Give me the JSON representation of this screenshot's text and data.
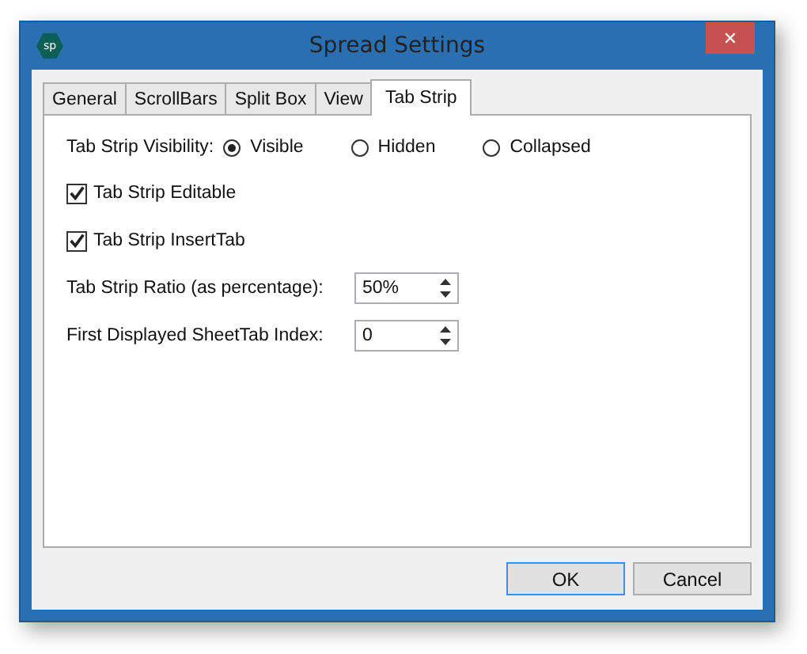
{
  "window": {
    "title": "Spread Settings",
    "icon_text": "sp",
    "close": "✕"
  },
  "tabs": [
    {
      "label": "General",
      "selected": false
    },
    {
      "label": "ScrollBars",
      "selected": false
    },
    {
      "label": "Split Box",
      "selected": false
    },
    {
      "label": "View",
      "selected": false
    },
    {
      "label": "Tab Strip",
      "selected": true
    }
  ],
  "visibility": {
    "label": "Tab Strip Visibility:",
    "options": [
      {
        "label": "Visible",
        "selected": true
      },
      {
        "label": "Hidden",
        "selected": false
      },
      {
        "label": "Collapsed",
        "selected": false
      }
    ]
  },
  "checkboxes": [
    {
      "label": "Tab Strip Editable",
      "checked": true
    },
    {
      "label": "Tab Strip InsertTab",
      "checked": true
    }
  ],
  "spinners": [
    {
      "label": "Tab Strip Ratio (as percentage):",
      "value": "50%"
    },
    {
      "label": "First Displayed SheetTab Index:",
      "value": "0"
    }
  ],
  "buttons": [
    {
      "label": "OK",
      "selected": true
    },
    {
      "label": "Cancel",
      "selected": false
    }
  ]
}
